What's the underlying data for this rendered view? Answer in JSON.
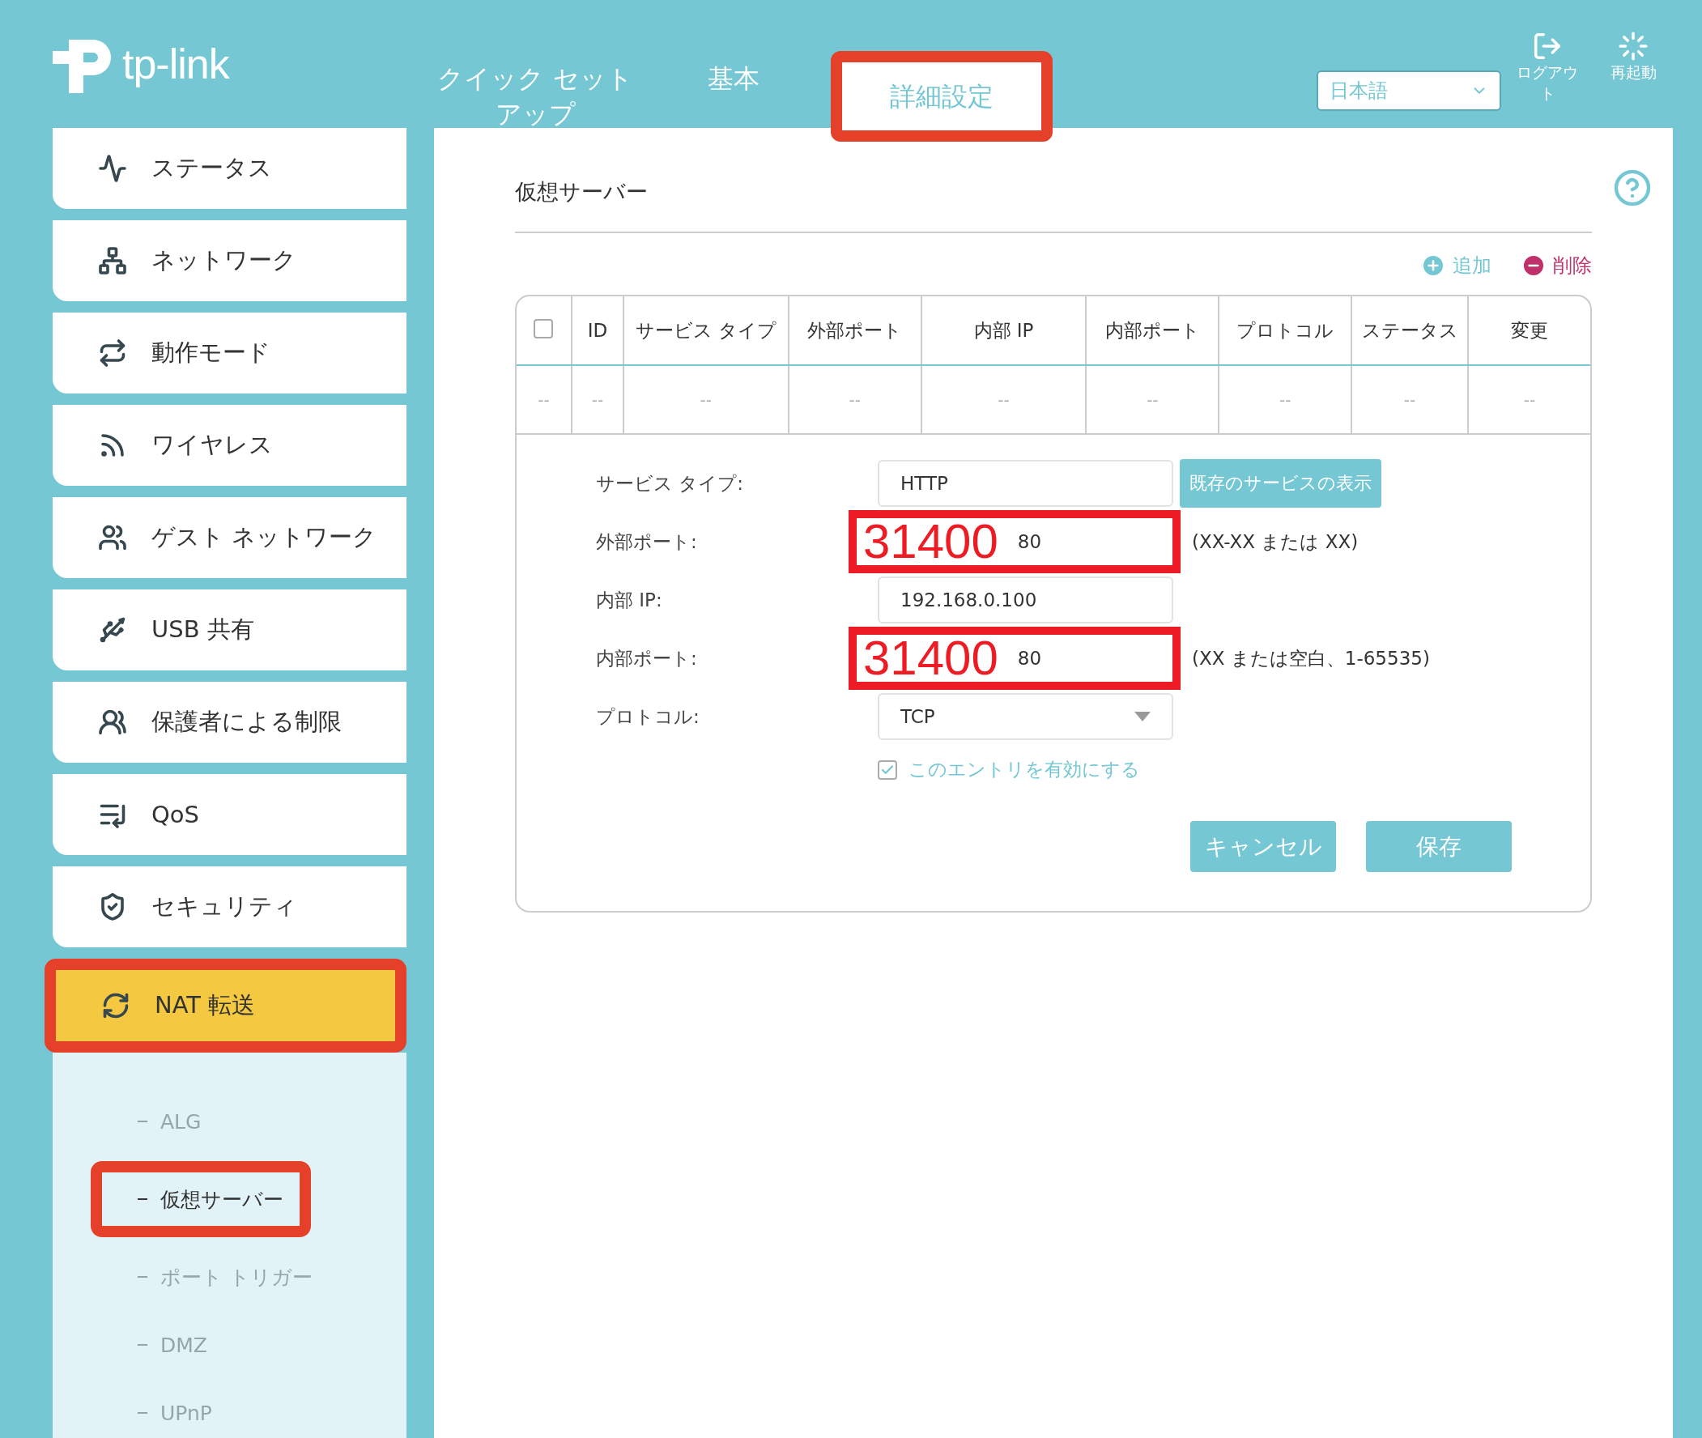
{
  "logo": {
    "text": "tp-link"
  },
  "nav_tabs": [
    {
      "label": "クイック セットアップ",
      "selected": false,
      "annotated": false
    },
    {
      "label": "基本",
      "selected": false,
      "annotated": false
    },
    {
      "label": "詳細設定",
      "selected": true,
      "annotated": true
    }
  ],
  "language_select": {
    "value": "日本語"
  },
  "header_actions": [
    {
      "label": "ログアウト",
      "kind": "logout"
    },
    {
      "label": "再起動",
      "kind": "reboot"
    }
  ],
  "sidebar": {
    "items": [
      {
        "label": "ステータス",
        "selected": false,
        "annotated": false
      },
      {
        "label": "ネットワーク",
        "selected": false,
        "annotated": false
      },
      {
        "label": "動作モード",
        "selected": false,
        "annotated": false
      },
      {
        "label": "ワイヤレス",
        "selected": false,
        "annotated": false
      },
      {
        "label": "ゲスト ネットワーク",
        "selected": false,
        "annotated": false
      },
      {
        "label": "USB 共有",
        "selected": false,
        "annotated": false
      },
      {
        "label": "保護者による制限",
        "selected": false,
        "annotated": false
      },
      {
        "label": "QoS",
        "selected": false,
        "annotated": false
      },
      {
        "label": "セキュリティ",
        "selected": false,
        "annotated": false
      },
      {
        "label": "NAT 転送",
        "selected": true,
        "annotated": true,
        "children": [
          {
            "label": "ALG",
            "selected": false,
            "annotated": false
          },
          {
            "label": "仮想サーバー",
            "selected": true,
            "annotated": true
          },
          {
            "label": "ポート トリガー",
            "selected": false,
            "annotated": false
          },
          {
            "label": "DMZ",
            "selected": false,
            "annotated": false
          },
          {
            "label": "UPnP",
            "selected": false,
            "annotated": false
          }
        ]
      }
    ]
  },
  "page_title": "仮想サーバー",
  "table_actions": [
    {
      "label": "追加",
      "kind": "add"
    },
    {
      "label": "削除",
      "kind": "delete"
    }
  ],
  "table": {
    "select_all_checked": false,
    "columns": [
      "",
      "ID",
      "サービス タイプ",
      "外部ポート",
      "内部 IP",
      "内部ポート",
      "プロトコル",
      "ステータス",
      "変更"
    ],
    "rows": [
      [
        "--",
        "--",
        "--",
        "--",
        "--",
        "--",
        "--",
        "--",
        "--"
      ]
    ]
  },
  "form": {
    "fields": [
      {
        "label": "サービス タイプ:",
        "kind": "text",
        "value": "HTTP",
        "button": "既存のサービスの表示"
      },
      {
        "label": "外部ポート:",
        "kind": "text",
        "value": "80",
        "hint": "(XX-XX または XX)",
        "annotation": "31400"
      },
      {
        "label": "内部 IP:",
        "kind": "text",
        "value": "192.168.0.100"
      },
      {
        "label": "内部ポート:",
        "kind": "text",
        "value": "80",
        "hint": "(XX または空白、1-65535)",
        "annotation": "31400"
      },
      {
        "label": "プロトコル:",
        "kind": "select",
        "value": "TCP"
      }
    ],
    "enable": {
      "label": "このエントリを有効にする",
      "checked": true
    },
    "buttons": [
      "キャンセル",
      "保存"
    ]
  }
}
